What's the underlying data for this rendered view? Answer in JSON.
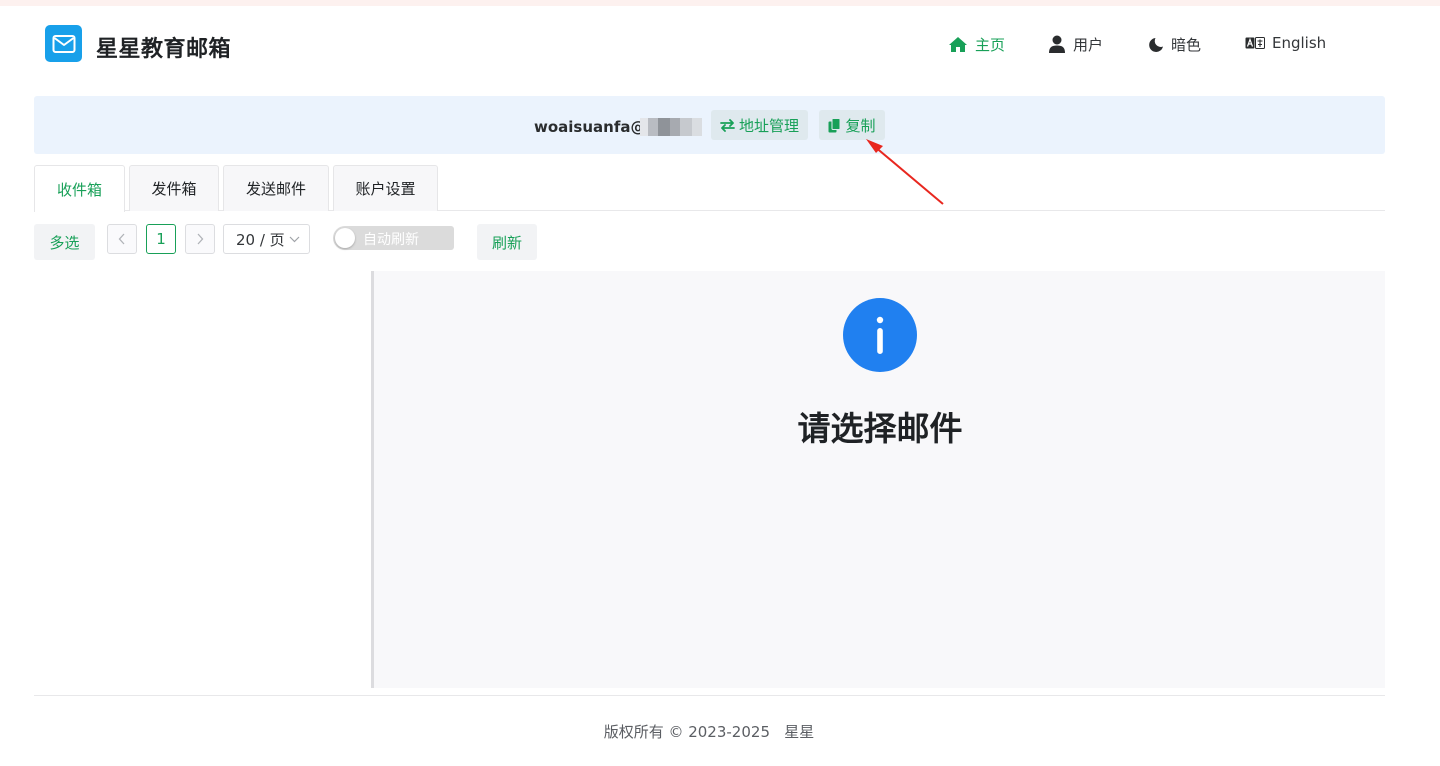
{
  "app": {
    "title": "星星教育邮箱",
    "logo_icon": "mail-icon",
    "brand_color": "#18a0ea",
    "accent_color": "#18a058"
  },
  "nav": [
    {
      "label": "主页",
      "icon": "home-icon",
      "active": true
    },
    {
      "label": "用户",
      "icon": "user-icon",
      "active": false
    },
    {
      "label": "暗色",
      "icon": "moon-icon",
      "active": false
    },
    {
      "label": "English",
      "icon": "language-icon",
      "active": false
    }
  ],
  "address": {
    "email_prefix": "woaisuanfa@",
    "manage_label": "地址管理",
    "manage_icon": "swap-icon",
    "copy_label": "复制",
    "copy_icon": "copy-icon"
  },
  "tabs": [
    {
      "label": "收件箱",
      "active": true
    },
    {
      "label": "发件箱",
      "active": false
    },
    {
      "label": "发送邮件",
      "active": false
    },
    {
      "label": "账户设置",
      "active": false
    }
  ],
  "toolbar": {
    "multi_select_label": "多选",
    "current_page": "1",
    "page_size_label": "20 / 页",
    "auto_refresh_label": "自动刷新",
    "auto_refresh_on": false,
    "refresh_label": "刷新"
  },
  "detail": {
    "empty_text": "请选择邮件",
    "empty_icon": "info-icon"
  },
  "footer": {
    "copyright": "版权所有 © 2023-2025   星星"
  }
}
